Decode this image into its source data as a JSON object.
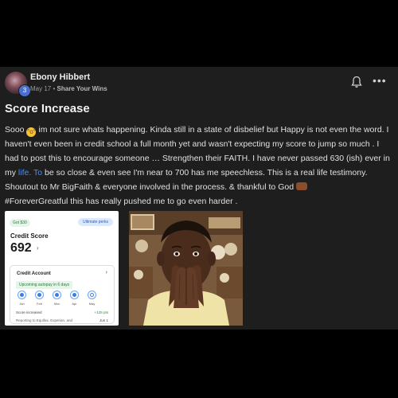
{
  "author": {
    "name": "Ebony Hibbert",
    "level": "3"
  },
  "meta": {
    "date": "May 17",
    "separator": "•",
    "group": "Share Your Wins"
  },
  "icons": {
    "bell": "bell-icon",
    "more": "more-options-icon",
    "surprise": "surprised-face-emoji",
    "praise": "praying-hands-emoji"
  },
  "more_label": "•••",
  "post": {
    "title": "Score Increase",
    "p1": "Sooo ",
    "p2": " im not sure whats happening. Kinda still in a state of disbelief but Happy is not even the word. I haven't even been in credit school a full month yet and wasn't expecting my score to jump so much . I had to post this to encourage someone … Strengthen their FAITH. I have never passed 630 (ish) ever in my ",
    "link": "life. To",
    "p3": " be so close & even see I'm near to 700 has me speechless. This is a real life testimony. Shoutout to Mr BigFaith & everyone involved in the process. & thankful to God ",
    "p4": "#ForeverGreatful this has really pushed me to go even harder ."
  },
  "card": {
    "got_pill": "Got $30",
    "ultimate_pill": "Ultimate perks",
    "score_label": "Credit Score",
    "score_value": "692",
    "score_arrow": "›",
    "account_label": "Credit Account",
    "account_chevron": "›",
    "upcoming": "Upcoming autopay in 6 days",
    "months": [
      "Jan",
      "Feb",
      "Mar",
      "Apr",
      "May"
    ],
    "score_increased_label": "Score increased",
    "score_increased_value": "+125 pts",
    "reporting": "Reporting to Equifax, Experian, and",
    "reporting_date": "Jun 1"
  },
  "colors": {
    "accent": "#4d8ef5",
    "background": "#1e1e1e",
    "positive": "#2b8a3e"
  }
}
